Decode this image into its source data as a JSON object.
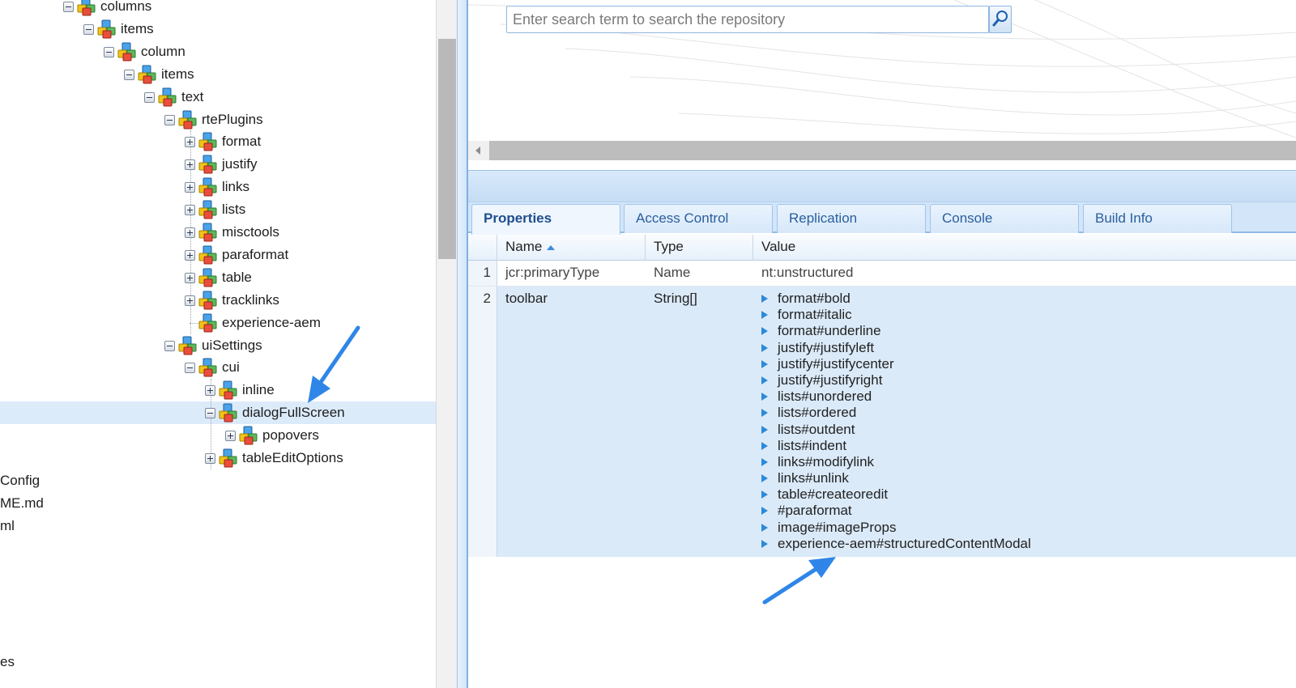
{
  "tree": {
    "nodes": [
      {
        "label": "columns",
        "toggle": "minus"
      },
      {
        "label": "items",
        "toggle": "minus"
      },
      {
        "label": "column",
        "toggle": "minus"
      },
      {
        "label": "items",
        "toggle": "minus"
      },
      {
        "label": "text",
        "toggle": "minus"
      },
      {
        "label": "rtePlugins",
        "toggle": "minus"
      },
      {
        "label": "format",
        "toggle": "plus"
      },
      {
        "label": "justify",
        "toggle": "plus"
      },
      {
        "label": "links",
        "toggle": "plus"
      },
      {
        "label": "lists",
        "toggle": "plus"
      },
      {
        "label": "misctools",
        "toggle": "plus"
      },
      {
        "label": "paraformat",
        "toggle": "plus"
      },
      {
        "label": "table",
        "toggle": "plus"
      },
      {
        "label": "tracklinks",
        "toggle": "plus"
      },
      {
        "label": "experience-aem",
        "toggle": "none"
      },
      {
        "label": "uiSettings",
        "toggle": "minus"
      },
      {
        "label": "cui",
        "toggle": "minus"
      },
      {
        "label": "inline",
        "toggle": "plus"
      },
      {
        "label": "dialogFullScreen",
        "toggle": "minus",
        "selected": true
      },
      {
        "label": "popovers",
        "toggle": "plus"
      },
      {
        "label": "tableEditOptions",
        "toggle": "plus"
      }
    ],
    "files": [
      "Config",
      "ME.md",
      "ml",
      "es"
    ]
  },
  "search": {
    "placeholder": "Enter search term to search the repository",
    "button_icon": "magnifier-icon"
  },
  "tabs": [
    {
      "label": "Properties",
      "active": true
    },
    {
      "label": "Access Control",
      "active": false
    },
    {
      "label": "Replication",
      "active": false
    },
    {
      "label": "Console",
      "active": false
    },
    {
      "label": "Build Info",
      "active": false
    }
  ],
  "grid": {
    "columns": [
      "Name",
      "Type",
      "Value"
    ],
    "sorted_column": "Name",
    "sort_direction": "ascending",
    "rows": [
      {
        "num": "1",
        "name": "jcr:primaryType",
        "type": "Name",
        "value": "nt:unstructured"
      },
      {
        "num": "2",
        "name": "toolbar",
        "type": "String[]",
        "values": [
          "format#bold",
          "format#italic",
          "format#underline",
          "justify#justifyleft",
          "justify#justifycenter",
          "justify#justifyright",
          "lists#unordered",
          "lists#ordered",
          "lists#outdent",
          "lists#indent",
          "links#modifylink",
          "links#unlink",
          "table#createoredit",
          "#paraformat",
          "image#imageProps",
          "experience-aem#structuredContentModal"
        ]
      }
    ]
  },
  "colors": {
    "accent": "#2d8ad8",
    "selection": "#dcebfa",
    "annotation_arrow": "#2f86e8"
  }
}
